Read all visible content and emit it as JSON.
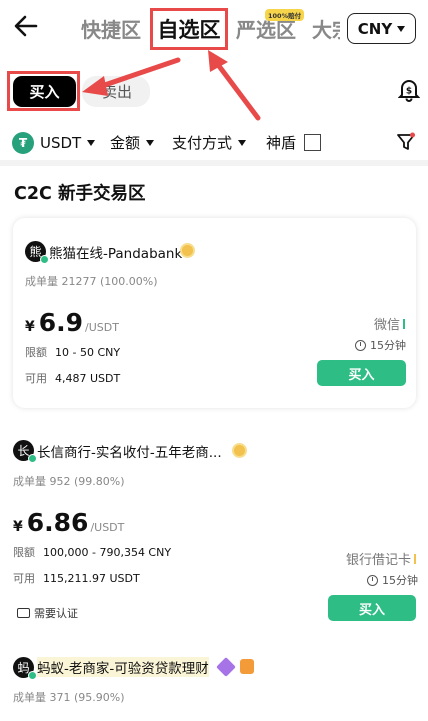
{
  "nav": {
    "tabs": [
      "快捷区",
      "自选区",
      "严选区",
      "大宗"
    ],
    "guarantee_badge": "100%赔付",
    "currency": "CNY"
  },
  "side": {
    "buy": "买入",
    "sell": "卖出"
  },
  "filters": {
    "coin": "USDT",
    "amount": "金额",
    "payment": "支付方式",
    "shield": "神盾"
  },
  "section_title": "C2C 新手交易区",
  "ads": [
    {
      "avatar": "熊",
      "merchant": "熊猫在线-Pandabank",
      "stat_label": "成单量",
      "stat_value": "21277 (100.00%)",
      "currency_symbol": "¥",
      "price": "6.9",
      "price_unit": "/USDT",
      "limit_label": "限额",
      "limit": "10 - 50 CNY",
      "avail_label": "可用",
      "available": "4,487 USDT",
      "payment": "微信",
      "payment_color": "#2dbd85",
      "time": "15分钟",
      "buy_label": "买入"
    },
    {
      "avatar": "长",
      "merchant": "长信商行-实名收付-五年老商...",
      "stat_label": "成单量",
      "stat_value": "952 (99.80%)",
      "currency_symbol": "¥",
      "price": "6.86",
      "price_unit": "/USDT",
      "limit_label": "限额",
      "limit": "100,000 - 790,354 CNY",
      "avail_label": "可用",
      "available": "115,211.97 USDT",
      "payment": "银行借记卡",
      "payment_color": "#f2c14e",
      "time": "15分钟",
      "buy_label": "买入",
      "verify": "需要认证"
    },
    {
      "avatar": "蚂",
      "merchant": "蚂蚁-老商家-可验资贷款理财",
      "stat_label": "成单量",
      "stat_value": "371 (95.90%)"
    }
  ],
  "colors": {
    "accent_green": "#2dbd85",
    "annotation_red": "#e84a4a"
  }
}
